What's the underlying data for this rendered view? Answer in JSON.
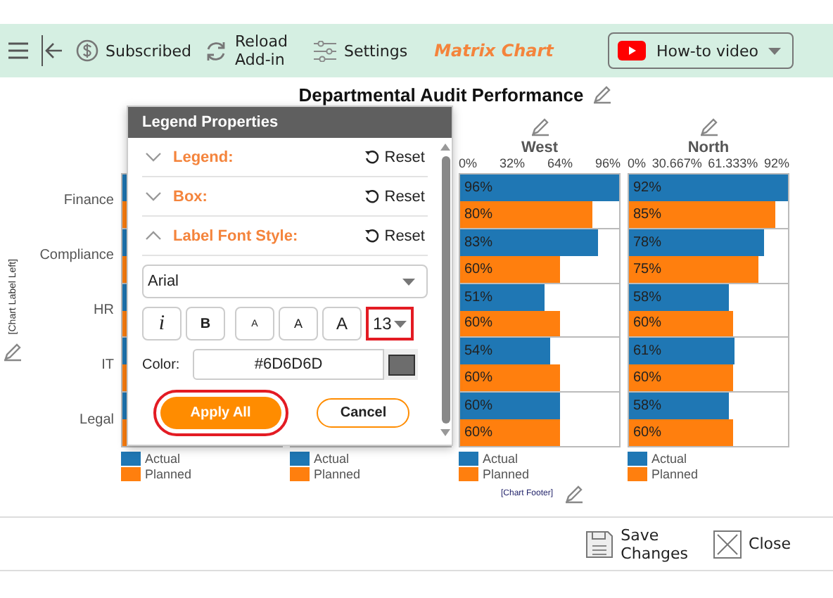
{
  "toolbar": {
    "subscribed": "Subscribed",
    "reload": "Reload\nAdd-in",
    "settings": "Settings",
    "app_title": "Matrix Chart",
    "video_button": "How-to video"
  },
  "chart": {
    "title": "Departmental Audit Performance",
    "y_axis_label": "[Chart Label Left]",
    "categories": [
      "Finance",
      "Compliance",
      "HR",
      "IT",
      "Legal"
    ],
    "footer": "[Chart Footer]",
    "panels": [
      {
        "legend": [
          {
            "label": "Actual",
            "color": "#1f77b4"
          },
          {
            "label": "Planned",
            "color": "#ff7f0e"
          }
        ]
      },
      {
        "legend": [
          {
            "label": "Actual",
            "color": "#1f77b4"
          },
          {
            "label": "Planned",
            "color": "#ff7f0e"
          }
        ]
      },
      {
        "header": "West",
        "ticks": [
          "0%",
          "32%",
          "64%",
          "96%"
        ],
        "bars": [
          {
            "label": "96%",
            "level": 1,
            "color": "#1f77b4"
          },
          {
            "label": "80%",
            "level": 0.833,
            "color": "#ff7f0e"
          },
          {
            "label": "83%",
            "level": 0.865,
            "color": "#1f77b4"
          },
          {
            "label": "60%",
            "level": 0.625,
            "color": "#ff7f0e"
          },
          {
            "label": "51%",
            "level": 0.531,
            "color": "#1f77b4"
          },
          {
            "label": "60%",
            "level": 0.625,
            "color": "#ff7f0e"
          },
          {
            "label": "54%",
            "level": 0.563,
            "color": "#1f77b4"
          },
          {
            "label": "60%",
            "level": 0.625,
            "color": "#ff7f0e"
          },
          {
            "label": "60%",
            "level": 0.625,
            "color": "#1f77b4"
          },
          {
            "label": "60%",
            "level": 0.625,
            "color": "#ff7f0e"
          }
        ],
        "legend": [
          {
            "label": "Actual",
            "color": "#1f77b4"
          },
          {
            "label": "Planned",
            "color": "#ff7f0e"
          }
        ]
      },
      {
        "header": "North",
        "ticks": [
          "0%",
          "30.667%",
          "61.333%",
          "92%"
        ],
        "bars": [
          {
            "label": "92%",
            "level": 1,
            "color": "#1f77b4"
          },
          {
            "label": "85%",
            "level": 0.924,
            "color": "#ff7f0e"
          },
          {
            "label": "78%",
            "level": 0.848,
            "color": "#1f77b4"
          },
          {
            "label": "75%",
            "level": 0.815,
            "color": "#ff7f0e"
          },
          {
            "label": "58%",
            "level": 0.63,
            "color": "#1f77b4"
          },
          {
            "label": "60%",
            "level": 0.652,
            "color": "#ff7f0e"
          },
          {
            "label": "61%",
            "level": 0.663,
            "color": "#1f77b4"
          },
          {
            "label": "60%",
            "level": 0.652,
            "color": "#ff7f0e"
          },
          {
            "label": "58%",
            "level": 0.63,
            "color": "#1f77b4"
          },
          {
            "label": "60%",
            "level": 0.652,
            "color": "#ff7f0e"
          }
        ],
        "legend": [
          {
            "label": "Actual",
            "color": "#1f77b4"
          },
          {
            "label": "Planned",
            "color": "#ff7f0e"
          }
        ]
      }
    ]
  },
  "dialog": {
    "title": "Legend Properties",
    "sections": [
      {
        "label": "Legend:",
        "expanded": false,
        "reset": "Reset"
      },
      {
        "label": "Box:",
        "expanded": false,
        "reset": "Reset"
      },
      {
        "label": "Label Font Style:",
        "expanded": true,
        "reset": "Reset"
      }
    ],
    "font": "Arial",
    "style_buttons": [
      {
        "kind": "italic",
        "label": "i"
      },
      {
        "kind": "bold",
        "label": "B"
      },
      {
        "kind": "small",
        "label": "A"
      },
      {
        "kind": "medium",
        "label": "A"
      },
      {
        "kind": "large",
        "label": "A"
      }
    ],
    "font_size": {
      "value": "13",
      "highlighted": true
    },
    "color_label": "Color:",
    "color_value": "#6D6D6D",
    "swatch": {
      "color": "#6d6d6d"
    },
    "apply": {
      "label": "Apply All",
      "highlighted": true
    },
    "cancel": "Cancel"
  },
  "footer": {
    "save": "Save\nChanges",
    "close": "Close"
  }
}
